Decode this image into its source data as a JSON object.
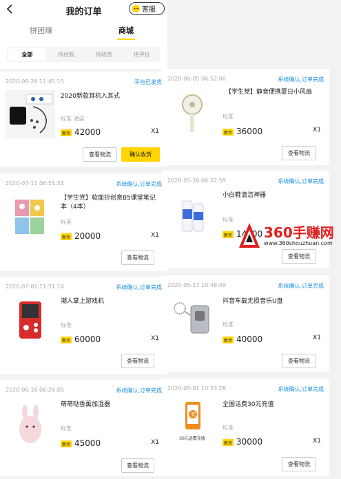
{
  "header": {
    "title": "我的订单",
    "service_label": "客服"
  },
  "top_tabs": [
    "拼团赚",
    "商城"
  ],
  "filter_tabs": [
    "全部",
    "待付款",
    "待收货",
    "待评价"
  ],
  "coin_label": "新币",
  "spec_label": "标准",
  "orders": [
    {
      "time": "2020-08-29 11:45:15",
      "status": "平台已发货",
      "name": "2020新款耳机入耳式",
      "spec": "标准 通蓝",
      "price": "42000",
      "qty": "X1",
      "btn1": "查看物流",
      "btn2": "确认收货"
    },
    {
      "time": "2020-07-11 06:51:31",
      "status": "系统确认,订单完成",
      "name": "【学生党】软面抄创意B5课堂笔记本（4本）",
      "spec": "标准",
      "price": "20000",
      "qty": "X1",
      "btn1": "查看物流"
    },
    {
      "time": "2020-07-01 11:51:14",
      "status": "系统确认,订单完成",
      "name": "潮人掌上游戏机",
      "spec": "标准",
      "price": "60000",
      "qty": "X1",
      "btn1": "查看物流"
    },
    {
      "time": "2020-06-16 06:26:05",
      "status": "系统确认,订单完成",
      "name": "萌萌哒香薰加湿器",
      "spec": "标准",
      "price": "45000",
      "qty": "X1",
      "btn1": "查看物流"
    },
    {
      "time": "2020-06-05 06:52:00",
      "status": "系统确认,订单完成",
      "name": "【学生党】静音便携夏日小风扇",
      "spec": "标准",
      "price": "36000",
      "qty": "X1",
      "btn1": "查看物流"
    },
    {
      "time": "2020-05-26 06:32:59",
      "status": "系统确认,订单完成",
      "name": "小白鞋清洁神器",
      "spec": "标准",
      "price": "14900",
      "qty": "X1",
      "btn1": "查看物流"
    },
    {
      "time": "2020-05-17 10:48:49",
      "status": "系统确认,订单完成",
      "name": "抖音车载无损音乐U盘",
      "spec": "标准",
      "price": "40000",
      "qty": "X1",
      "btn1": "查看物流"
    },
    {
      "time": "2020-05-01 10:33:28",
      "status": "系统确认,订单完成",
      "name": "全国话费30元充值",
      "spec": "标准",
      "price": "30000",
      "qty": "X1",
      "btn1": "查看物流",
      "thumb_text": "30元话费充值",
      "thumb_glyph": "充"
    }
  ],
  "watermark": {
    "title": "360手赚网",
    "url": "www.360shouzhuan.com"
  }
}
